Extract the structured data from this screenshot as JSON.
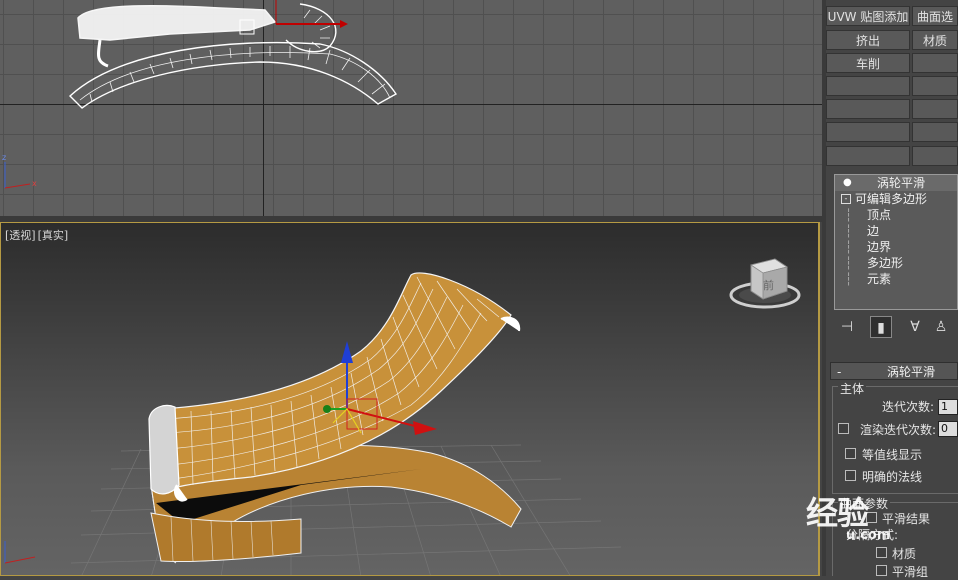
{
  "viewport_persp": {
    "label_view": "[透视]",
    "label_shading": "[真实]"
  },
  "viewcube": {
    "face": "前"
  },
  "modifier_buttons": [
    "UVW 贴图添加",
    "曲面选",
    "挤出",
    "材质",
    "车削"
  ],
  "stack": {
    "top": "涡轮平滑",
    "base": "可编辑多边形",
    "sub": [
      "顶点",
      "边",
      "边界",
      "多边形",
      "元素"
    ]
  },
  "rollout": {
    "collapse": "-",
    "title": "涡轮平滑",
    "group_main": "主体",
    "iterations_label": "迭代次数:",
    "iterations_value": "1",
    "render_iters_label": "渲染迭代次数:",
    "render_iters_value": "0",
    "isoline_label": "等值线显示",
    "explicit_normals_label": "明确的法线",
    "surface_params": "曲面参数",
    "smooth_result": "平滑结果",
    "separate_by": "分隔方式:",
    "materials": "材质",
    "smoothing_groups": "平滑组"
  },
  "watermark": {
    "main": "经验",
    "sub": "u.com"
  },
  "colors": {
    "accent_border": "#b59a43",
    "mesh_fill": "#c8913a",
    "wire": "#f2f2f2"
  }
}
